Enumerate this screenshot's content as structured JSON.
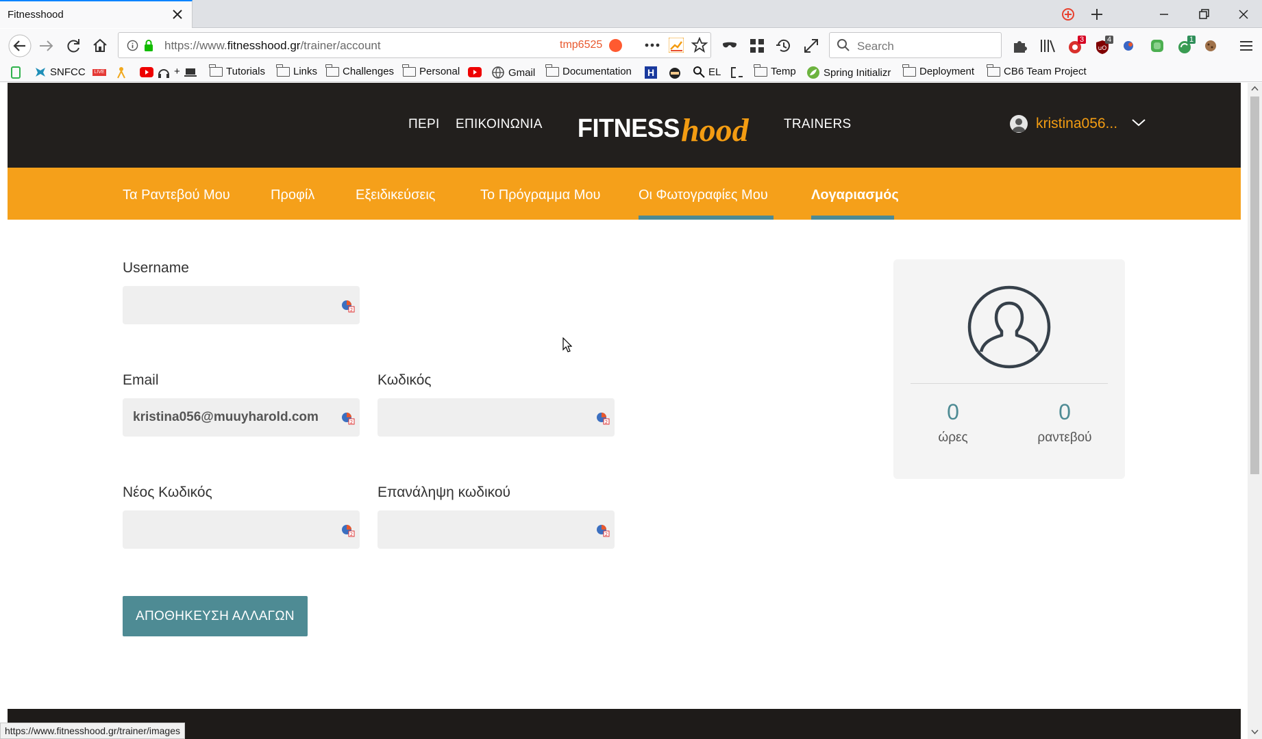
{
  "browser": {
    "tab_title": "Fitnesshood",
    "url_prefix": "https://www.",
    "url_host": "fitnesshood.gr",
    "url_path": "/trainer/account",
    "container_badge": "tmp6525",
    "search_placeholder": "Search",
    "bookmarks": [
      "SNFCC",
      "+",
      "Tutorials",
      "Links",
      "Challenges",
      "Personal",
      "Gmail",
      "Documentation",
      "EL",
      "Temp",
      "Spring Initializr",
      "Deployment",
      "CB6 Team Project"
    ],
    "badges": {
      "ext1": "3",
      "ext2": "4",
      "ext3": "1"
    },
    "status_url": "https://www.fitnesshood.gr/trainer/images"
  },
  "header": {
    "nav_about": "ΠΕΡΙ",
    "nav_contact": "ΕΠΙΚΟΙΝΩΝΙΑ",
    "logo_fitness": "FITNESS",
    "logo_hood": "hood",
    "nav_trainers": "TRAINERS",
    "user_name": "kristina056..."
  },
  "subnav": {
    "items": [
      {
        "label": "Τα Ραντεβού Μου"
      },
      {
        "label": "Προφίλ"
      },
      {
        "label": "Εξειδικεύσεις"
      },
      {
        "label": "Το Πρόγραμμα Μου"
      },
      {
        "label": "Οι Φωτογραφίες Μου"
      },
      {
        "label": "Λογαριασμός"
      }
    ]
  },
  "form": {
    "username_label": "Username",
    "username_value": "",
    "email_label": "Email",
    "email_value": "kristina056@muuyharold.com",
    "password_label": "Κωδικός",
    "password_value": "",
    "new_password_label": "Νέος Κωδικός",
    "new_password_value": "",
    "repeat_password_label": "Επανάληψη κωδικού",
    "repeat_password_value": "",
    "save_label": "ΑΠΟΘΗΚΕΥΣΗ ΑΛΛΑΓΩΝ"
  },
  "stats": {
    "hours_value": "0",
    "hours_label": "ώρες",
    "appointments_value": "0",
    "appointments_label": "ραντεβού"
  },
  "colors": {
    "accent_orange": "#f5a01a",
    "teal": "#4e8b94",
    "header_dark": "#221f1d"
  }
}
